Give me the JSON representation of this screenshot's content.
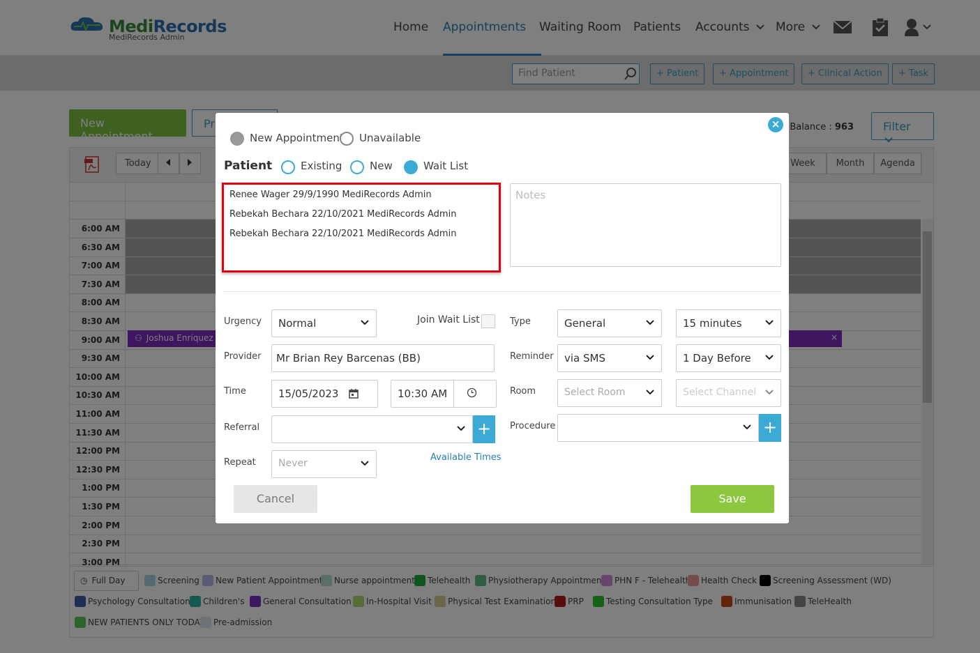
{
  "app": {
    "logo_title_a": "Medi",
    "logo_title_b": "Records",
    "logo_subtitle": "MediRecords Admin"
  },
  "nav": {
    "items": [
      {
        "label": "Home"
      },
      {
        "label": "Appointments",
        "active": true
      },
      {
        "label": "Waiting Room"
      },
      {
        "label": "Patients"
      },
      {
        "label": "Accounts"
      },
      {
        "label": "More"
      }
    ],
    "icons": [
      "mail-icon",
      "clipboard-icon",
      "user-icon"
    ]
  },
  "toolbar": {
    "find_placeholder": "Find Patient",
    "buttons": [
      "+ Patient",
      "+ Appointment",
      "+ Clinical Action",
      "+ Task"
    ]
  },
  "page": {
    "new_appointment": "New Appointment",
    "print": "Pr",
    "sms_balance_label": "S Balance : ",
    "sms_balance_value": "963",
    "filter": "Filter"
  },
  "calendar": {
    "today": "Today",
    "views": [
      "Week",
      "Month",
      "Agenda"
    ],
    "times": [
      "6:00 AM",
      "6:30 AM",
      "7:00 AM",
      "7:30 AM",
      "8:00 AM",
      "8:30 AM",
      "9:00 AM",
      "9:30 AM",
      "10:00 AM",
      "10:30 AM",
      "11:00 AM",
      "11:30 AM",
      "12:00 PM",
      "12:30 PM",
      "1:00 PM",
      "1:30 PM",
      "2:00 PM",
      "2:30 PM",
      "3:00 PM"
    ],
    "event_label": "Joshua Enriquez - "
  },
  "legend": {
    "full_day": "Full Day",
    "items": [
      {
        "label": "Screening",
        "color": "#a8d4e6"
      },
      {
        "label": "New Patient Appointment",
        "color": "#b8b8e8"
      },
      {
        "label": "Nurse appointment",
        "color": "#b8dcd0"
      },
      {
        "label": "Telehealth",
        "color": "#1aa83a"
      },
      {
        "label": "Physiotherapy Appointment",
        "color": "#5cb88a"
      },
      {
        "label": "PHN F - Telehealth",
        "color": "#d08ad8"
      },
      {
        "label": "Health Check",
        "color": "#e89898"
      },
      {
        "label": "Screening Assessment (WD)",
        "color": "#000000"
      },
      {
        "label": "Psychology Consultation",
        "color": "#3a5aa8"
      },
      {
        "label": "Children's",
        "color": "#28b0a0"
      },
      {
        "label": "General Consultation",
        "color": "#7b2cbf"
      },
      {
        "label": "In-Hospital Visit",
        "color": "#b0d870"
      },
      {
        "label": "Physical Test Examination",
        "color": "#d8cc88"
      },
      {
        "label": "PRP",
        "color": "#b01818"
      },
      {
        "label": "Testing Consultation Type",
        "color": "#28c428"
      },
      {
        "label": "Immunisation",
        "color": "#c84818"
      },
      {
        "label": "TeleHealth",
        "color": "#888888"
      },
      {
        "label": "NEW PATIENTS ONLY TODAY",
        "color": "#58c858"
      },
      {
        "label": "Pre-admission",
        "color": "#dde6f0"
      }
    ]
  },
  "modal": {
    "mode_options": [
      {
        "label": "New Appointment",
        "state": "selected-gray"
      },
      {
        "label": "Unavailable",
        "state": "empty"
      }
    ],
    "patient_label": "Patient",
    "patient_options": [
      {
        "label": "Existing"
      },
      {
        "label": "New"
      },
      {
        "label": "Wait List",
        "selected": true
      }
    ],
    "wait_list": [
      "Renee Wager 29/9/1990 MediRecords Admin",
      "Rebekah Bechara 22/10/2021 MediRecords Admin",
      "Rebekah Bechara 22/10/2021 MediRecords Admin"
    ],
    "notes_placeholder": "Notes",
    "urgency_label": "Urgency",
    "urgency_value": "Normal",
    "join_wait_list_label": "Join Wait List",
    "type_label": "Type",
    "type_value": "General",
    "duration_value": "15 minutes",
    "provider_label": "Provider",
    "provider_value": "Mr Brian Rey Barcenas (BB)",
    "reminder_label": "Reminder",
    "reminder_value": "via SMS",
    "reminder_timing": "1 Day Before",
    "time_label": "Time",
    "date_value": "15/05/2023",
    "time_value": "10:30 AM",
    "room_label": "Room",
    "room_placeholder": "Select Room",
    "channel_placeholder": "Select Channel",
    "referral_label": "Referral",
    "procedure_label": "Procedure",
    "repeat_label": "Repeat",
    "repeat_value": "Never",
    "available_times": "Available Times",
    "cancel": "Cancel",
    "save": "Save"
  }
}
